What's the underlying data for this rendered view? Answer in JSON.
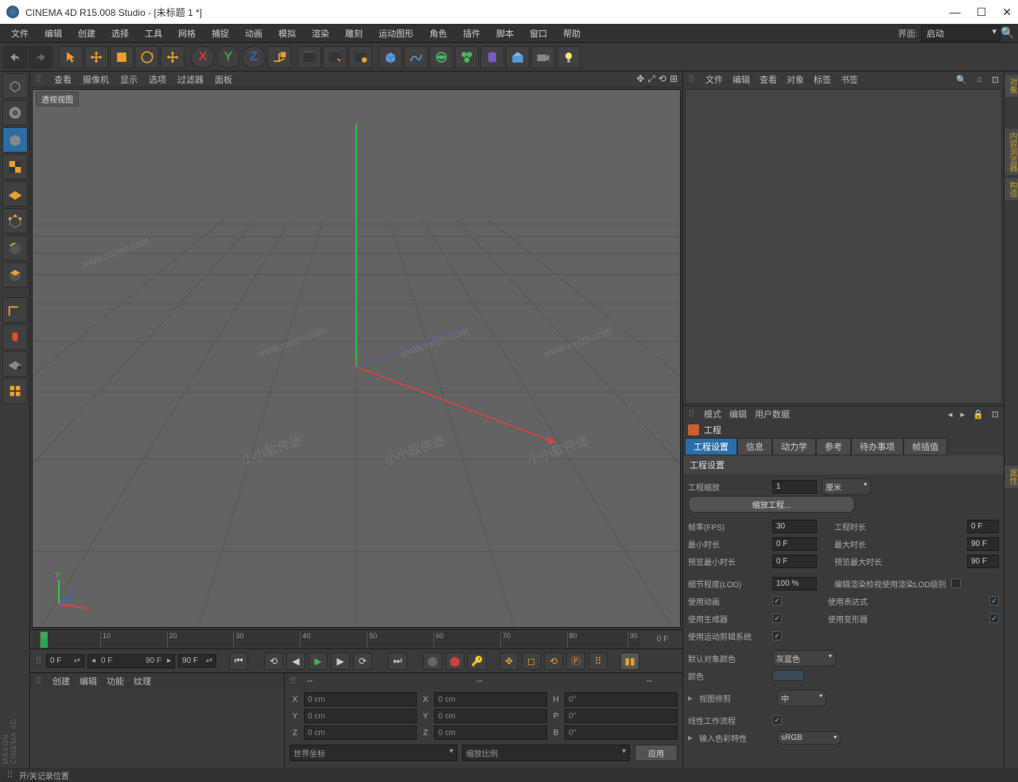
{
  "title": "CINEMA 4D R15.008 Studio - [未标题 1 *]",
  "menu": {
    "items": [
      "文件",
      "编辑",
      "创建",
      "选择",
      "工具",
      "网格",
      "捕捉",
      "动画",
      "模拟",
      "渲染",
      "雕刻",
      "运动图形",
      "角色",
      "插件",
      "脚本",
      "窗口",
      "帮助"
    ],
    "ui_label": "界面:",
    "ui_value": "启动"
  },
  "viewport": {
    "menu": [
      "查看",
      "摄像机",
      "显示",
      "选项",
      "过滤器",
      "面板"
    ],
    "label": "透视视图"
  },
  "timeline": {
    "ticks": [
      "0",
      "10",
      "20",
      "30",
      "40",
      "50",
      "60",
      "70",
      "80",
      "90"
    ],
    "end": "0 F"
  },
  "transport": {
    "cur": "0 F",
    "range_start": "0 F",
    "range_end": "90 F",
    "cur2": "90 F"
  },
  "bottom_left": {
    "tabs": [
      "创建",
      "编辑",
      "功能",
      "纹理"
    ]
  },
  "coords": {
    "header": [
      "--",
      "--",
      "--"
    ],
    "rows": [
      {
        "a": "X",
        "av": "0 cm",
        "b": "X",
        "bv": "0 cm",
        "c": "H",
        "cv": "0°"
      },
      {
        "a": "Y",
        "av": "0 cm",
        "b": "Y",
        "bv": "0 cm",
        "c": "P",
        "cv": "0°"
      },
      {
        "a": "Z",
        "av": "0 cm",
        "b": "Z",
        "bv": "0 cm",
        "c": "B",
        "cv": "0°"
      }
    ],
    "drop1": "世界坐标",
    "drop2": "缩放比例",
    "apply": "应用"
  },
  "objmgr": {
    "menu": [
      "文件",
      "编辑",
      "查看",
      "对象",
      "标签",
      "书签"
    ]
  },
  "attr": {
    "head": [
      "模式",
      "编辑",
      "用户数据"
    ],
    "title": "工程",
    "tabs": [
      "工程设置",
      "信息",
      "动力学",
      "参考",
      "待办事项",
      "帧插值"
    ],
    "section": "工程设置",
    "scale_label": "工程缩放",
    "scale_val": "1",
    "scale_unit": "厘米",
    "scale_btn": "缩放工程...",
    "fps_label": "帧率(FPS)",
    "fps_val": "30",
    "projtime_label": "工程时长",
    "projtime_val": "0 F",
    "mintime_label": "最小时长",
    "mintime_val": "0 F",
    "maxtime_label": "最大时长",
    "maxtime_val": "90 F",
    "prevmin_label": "预览最小时长",
    "prevmin_val": "0 F",
    "prevmax_label": "预览最大时长",
    "prevmax_val": "90 F",
    "lod_label": "细节程度(LOD)",
    "lod_val": "100 %",
    "lod_chk_label": "编辑渲染检视使用渲染LOD级别",
    "anim_label": "使用动画",
    "expr_label": "使用表达式",
    "gen_label": "使用生成器",
    "deform_label": "使用变形器",
    "motion_label": "使用运动剪辑系统",
    "defcolor_label": "默认对象颜色",
    "defcolor_val": "灰蓝色",
    "color_label": "颜色",
    "clip_label": "视图修剪",
    "clip_val": "中",
    "linear_label": "线性工作流程",
    "srgb_label": "输入色彩特性",
    "srgb_val": "sRGB"
  },
  "status": "开/关记录位置",
  "sidetabs": [
    "对象",
    "内容浏览器",
    "构造"
  ],
  "far2": "属性",
  "wm_url": "www.xxrjm.com",
  "wm_cn": "小小软件迷"
}
